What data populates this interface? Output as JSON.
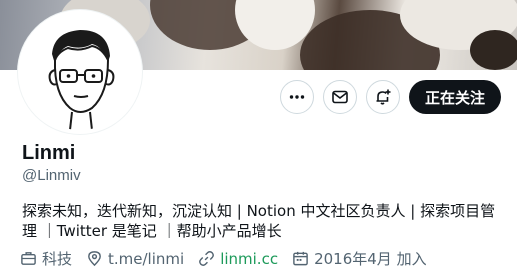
{
  "profile": {
    "name": "Linmi",
    "handle": "@Linmiv",
    "bio": "探索未知，迭代新知，沉淀认知 | Notion 中文社区负责人 | 探索项目管理 ｜Twitter 是笔记 ｜帮助小产品增长",
    "follow_label": "正在关注"
  },
  "meta": {
    "category": "科技",
    "telegram": "t.me/linmi",
    "website": "linmi.cc",
    "joined": "2016年4月 加入"
  },
  "icons": {
    "more": "more-icon",
    "message": "message-icon",
    "notify": "notification-add-icon",
    "category": "briefcase-icon",
    "location": "location-pin-icon",
    "link": "link-icon",
    "calendar": "calendar-icon"
  },
  "colors": {
    "follow_bg": "#0f1419",
    "link": "#1d9a5a",
    "secondary_text": "#536471"
  }
}
